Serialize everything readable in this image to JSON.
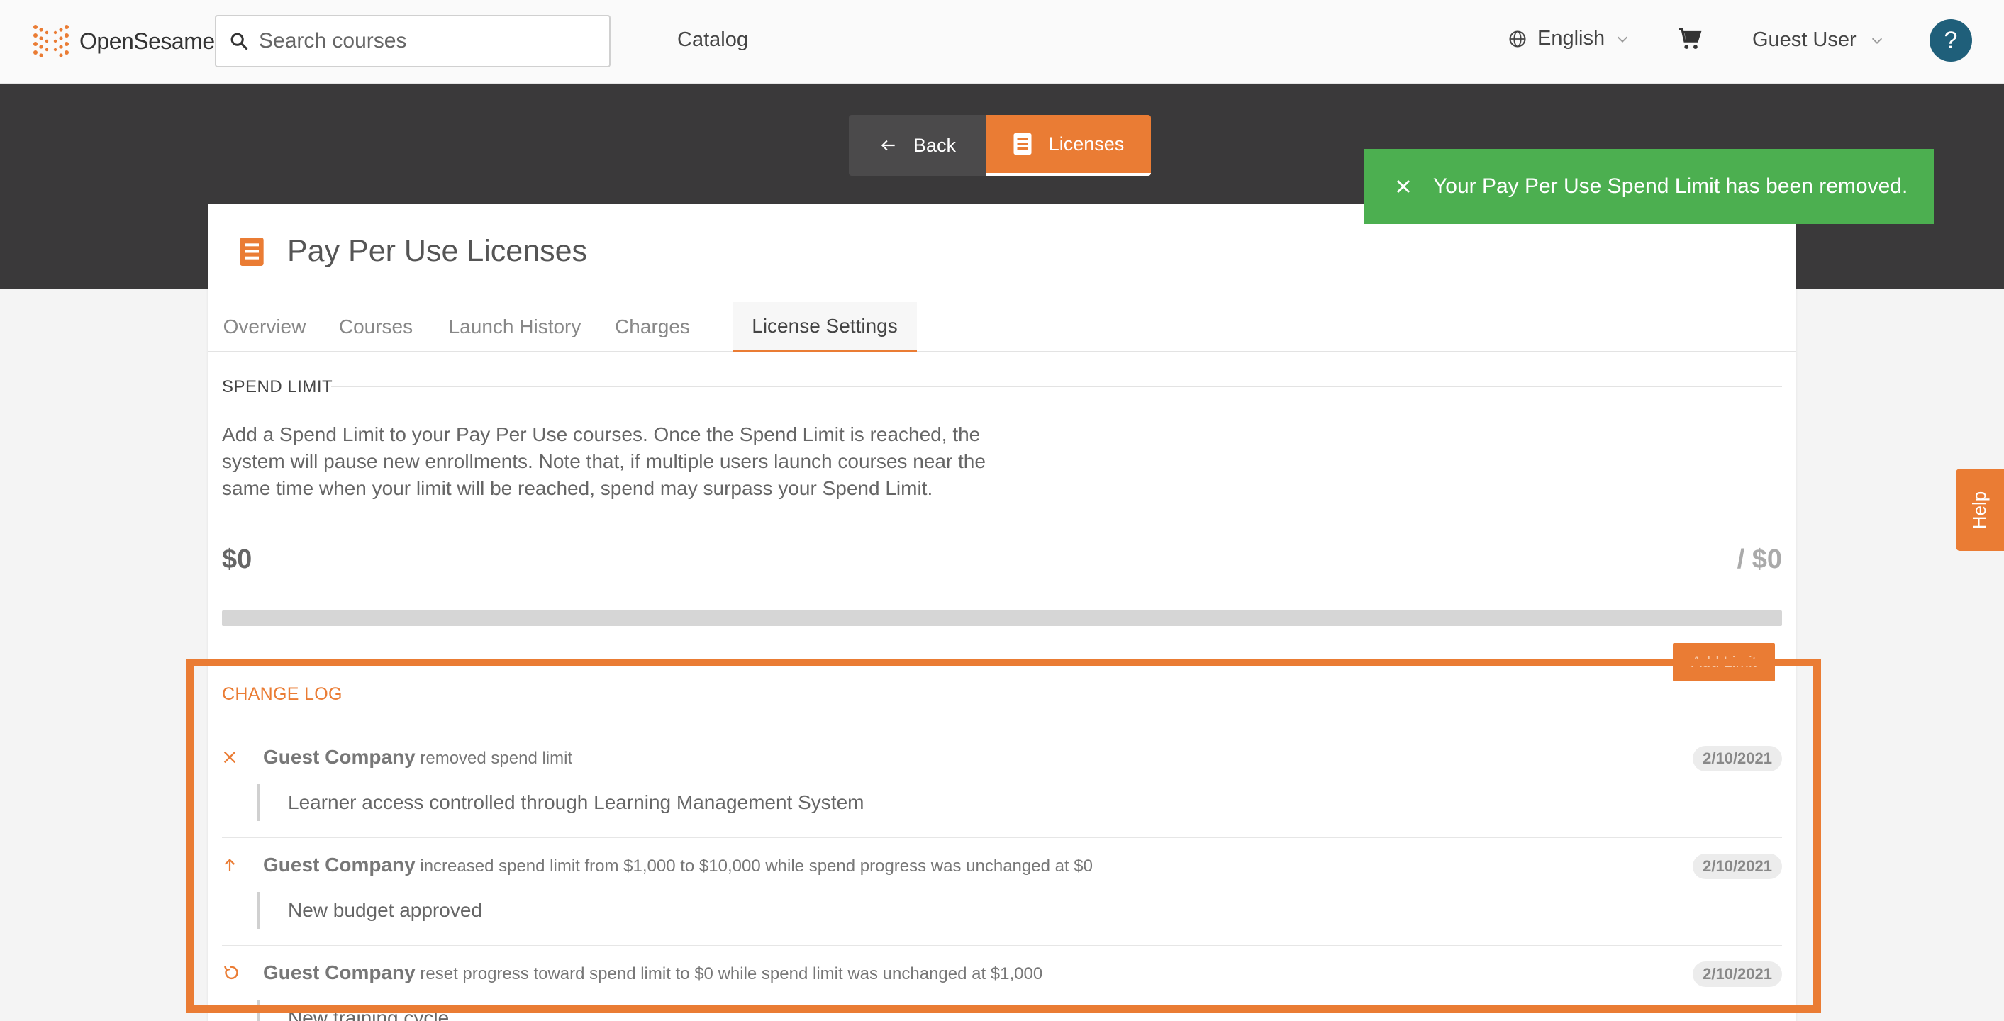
{
  "header": {
    "logo_text": "OpenSesame",
    "search_placeholder": "Search courses",
    "catalog_label": "Catalog",
    "language_label": "English",
    "user_label": "Guest User",
    "help_label": "?"
  },
  "nav": {
    "back_label": "Back",
    "licenses_label": "Licenses"
  },
  "toast": {
    "message": "Your Pay Per Use Spend Limit has been removed."
  },
  "page": {
    "title": "Pay Per Use Licenses",
    "tabs": [
      {
        "label": "Overview"
      },
      {
        "label": "Courses"
      },
      {
        "label": "Launch History"
      },
      {
        "label": "Charges"
      },
      {
        "label": "License Settings",
        "active": true
      }
    ]
  },
  "spend_limit": {
    "section_label": "SPEND LIMIT",
    "description": "Add a Spend Limit to your Pay Per Use courses. Once the Spend Limit is reached, the system will pause new enrollments. Note that, if multiple users launch courses near the same time when your limit will be reached, spend may surpass your Spend Limit.",
    "spent": "$0",
    "limit": "/ $0",
    "progress_fraction": 0,
    "add_button_label": "Add Limit"
  },
  "changelog": {
    "title": "CHANGE LOG",
    "entries": [
      {
        "icon": "close-icon",
        "actor": "Guest Company",
        "action": "removed spend limit",
        "date": "2/10/2021",
        "note": "Learner access controlled through Learning Management System"
      },
      {
        "icon": "arrow-up-icon",
        "actor": "Guest Company",
        "action": "increased spend limit from $1,000 to $10,000 while spend progress was unchanged at $0",
        "date": "2/10/2021",
        "note": "New budget approved"
      },
      {
        "icon": "reset-icon",
        "actor": "Guest Company",
        "action": "reset progress toward spend limit to $0 while spend limit was unchanged at $1,000",
        "date": "2/10/2021",
        "note": "New training cycle"
      }
    ]
  },
  "side_help": {
    "label": "Help"
  },
  "colors": {
    "accent": "#ea7c34",
    "toast": "#4caf50",
    "band": "#3a393a",
    "help_circle": "#1f5f7a"
  }
}
